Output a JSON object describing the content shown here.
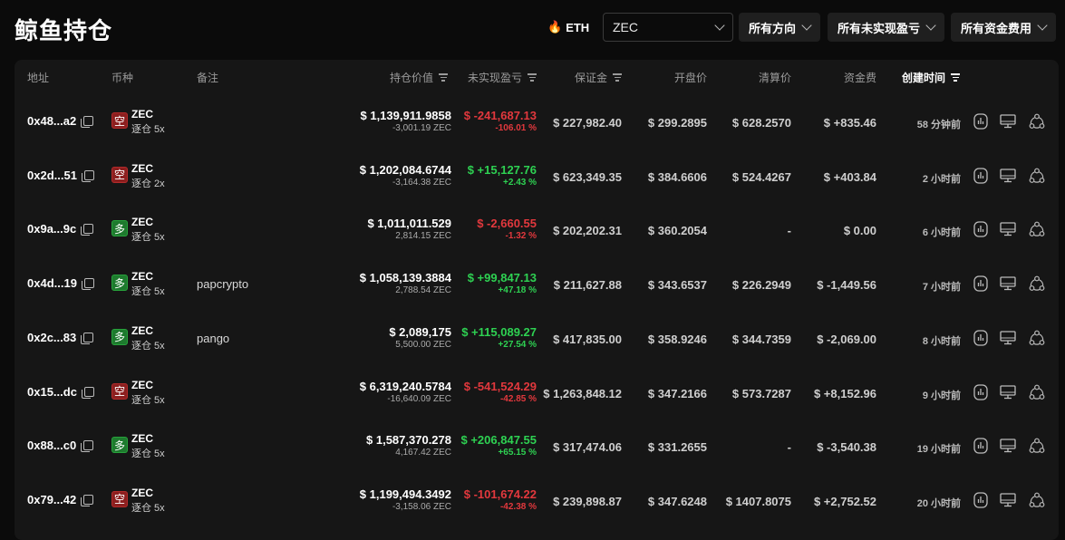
{
  "header": {
    "title": "鲸鱼持仓",
    "eth_label": "ETH",
    "coin_select": "ZEC",
    "filters": [
      "所有方向",
      "所有未实现盈亏",
      "所有资金费用"
    ]
  },
  "table": {
    "columns": {
      "address": "地址",
      "coin": "币种",
      "note": "备注",
      "position_value": "持仓价值",
      "unrealized_pnl": "未实现盈亏",
      "margin": "保证金",
      "entry_price": "开盘价",
      "liq_price": "清算价",
      "funding": "资金费",
      "created": "创建时间"
    },
    "rows": [
      {
        "address": "0x48...a2",
        "side": "空",
        "side_type": "short",
        "coin": "ZEC",
        "mode": "逐仓 5x",
        "note": "",
        "value": "$ 1,139,911.9858",
        "qty": "-3,001.19 ZEC",
        "pnl": "$ -241,687.13",
        "pnl_pct": "-106.01 %",
        "pnl_sign": "neg",
        "margin": "$ 227,982.40",
        "entry": "$ 299.2895",
        "liq": "$ 628.2570",
        "funding": "$ +835.46",
        "funding_sign": "pos",
        "time": "58 分钟前"
      },
      {
        "address": "0x2d...51",
        "side": "空",
        "side_type": "short",
        "coin": "ZEC",
        "mode": "逐仓 2x",
        "note": "",
        "value": "$ 1,202,084.6744",
        "qty": "-3,164.38 ZEC",
        "pnl": "$ +15,127.76",
        "pnl_pct": "+2.43 %",
        "pnl_sign": "pos",
        "margin": "$ 623,349.35",
        "entry": "$ 384.6606",
        "liq": "$ 524.4267",
        "funding": "$ +403.84",
        "funding_sign": "pos",
        "time": "2 小时前"
      },
      {
        "address": "0x9a...9c",
        "side": "多",
        "side_type": "long",
        "coin": "ZEC",
        "mode": "逐仓 5x",
        "note": "",
        "value": "$ 1,011,011.529",
        "qty": "2,814.15 ZEC",
        "pnl": "$ -2,660.55",
        "pnl_pct": "-1.32 %",
        "pnl_sign": "neg",
        "margin": "$ 202,202.31",
        "entry": "$ 360.2054",
        "liq": "-",
        "funding": "$ 0.00",
        "funding_sign": "zero",
        "time": "6 小时前"
      },
      {
        "address": "0x4d...19",
        "side": "多",
        "side_type": "long",
        "coin": "ZEC",
        "mode": "逐仓 5x",
        "note": "papcrypto",
        "value": "$ 1,058,139.3884",
        "qty": "2,788.54 ZEC",
        "pnl": "$ +99,847.13",
        "pnl_pct": "+47.18 %",
        "pnl_sign": "pos",
        "margin": "$ 211,627.88",
        "entry": "$ 343.6537",
        "liq": "$ 226.2949",
        "funding": "$ -1,449.56",
        "funding_sign": "neg",
        "time": "7 小时前"
      },
      {
        "address": "0x2c...83",
        "side": "多",
        "side_type": "long",
        "coin": "ZEC",
        "mode": "逐仓 5x",
        "note": "pango",
        "value": "$ 2,089,175",
        "qty": "5,500.00 ZEC",
        "pnl": "$ +115,089.27",
        "pnl_pct": "+27.54 %",
        "pnl_sign": "pos",
        "margin": "$ 417,835.00",
        "entry": "$ 358.9246",
        "liq": "$ 344.7359",
        "funding": "$ -2,069.00",
        "funding_sign": "neg",
        "time": "8 小时前"
      },
      {
        "address": "0x15...dc",
        "side": "空",
        "side_type": "short",
        "coin": "ZEC",
        "mode": "逐仓 5x",
        "note": "",
        "value": "$ 6,319,240.5784",
        "qty": "-16,640.09 ZEC",
        "pnl": "$ -541,524.29",
        "pnl_pct": "-42.85 %",
        "pnl_sign": "neg",
        "margin": "$ 1,263,848.12",
        "entry": "$ 347.2166",
        "liq": "$ 573.7287",
        "funding": "$ +8,152.96",
        "funding_sign": "pos",
        "time": "9 小时前"
      },
      {
        "address": "0x88...c0",
        "side": "多",
        "side_type": "long",
        "coin": "ZEC",
        "mode": "逐仓 5x",
        "note": "",
        "value": "$ 1,587,370.278",
        "qty": "4,167.42 ZEC",
        "pnl": "$ +206,847.55",
        "pnl_pct": "+65.15 %",
        "pnl_sign": "pos",
        "margin": "$ 317,474.06",
        "entry": "$ 331.2655",
        "liq": "-",
        "funding": "$ -3,540.38",
        "funding_sign": "neg",
        "time": "19 小时前"
      },
      {
        "address": "0x79...42",
        "side": "空",
        "side_type": "short",
        "coin": "ZEC",
        "mode": "逐仓 5x",
        "note": "",
        "value": "$ 1,199,494.3492",
        "qty": "-3,158.06 ZEC",
        "pnl": "$ -101,674.22",
        "pnl_pct": "-42.38 %",
        "pnl_sign": "neg",
        "margin": "$ 239,898.87",
        "entry": "$ 347.6248",
        "liq": "$ 1407.8075",
        "funding": "$ +2,752.52",
        "funding_sign": "pos",
        "time": "20 小时前"
      }
    ],
    "row_actions": [
      "chart-icon",
      "monitor-icon",
      "share-icon"
    ]
  },
  "colors": {
    "positive": "#2ed152",
    "negative": "#e2383d",
    "short_badge": "#8c1f1f",
    "long_badge": "#1e7a2e"
  }
}
